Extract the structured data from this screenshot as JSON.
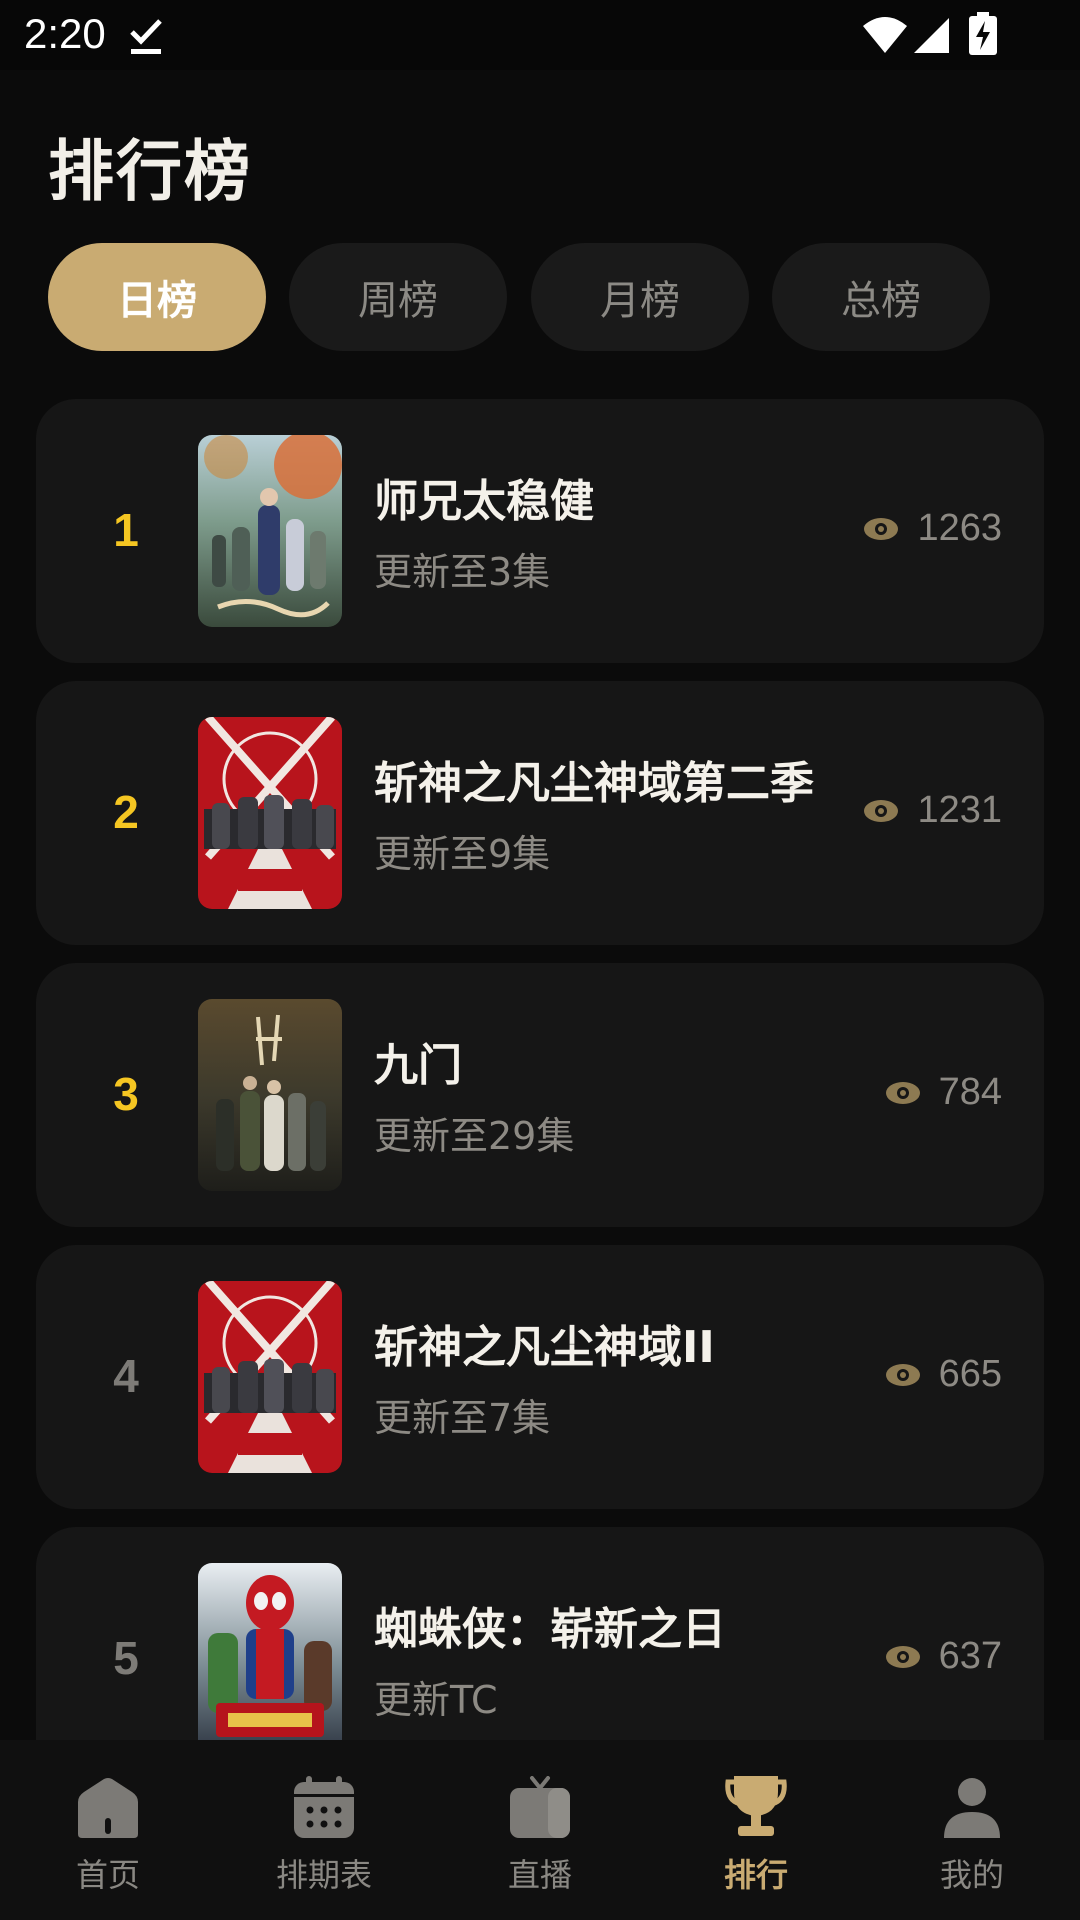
{
  "status_bar": {
    "time": "2:20"
  },
  "header": {
    "title": "排行榜"
  },
  "tabs": [
    {
      "label": "日榜",
      "active": true
    },
    {
      "label": "周榜",
      "active": false
    },
    {
      "label": "月榜",
      "active": false
    },
    {
      "label": "总榜",
      "active": false
    }
  ],
  "rankings": [
    {
      "rank": "1",
      "title": "师兄太稳健",
      "subtitle": "更新至3集",
      "views": "1263"
    },
    {
      "rank": "2",
      "title": "斩神之凡尘神域第二季",
      "subtitle": "更新至9集",
      "views": "1231"
    },
    {
      "rank": "3",
      "title": "九门",
      "subtitle": "更新至29集",
      "views": "784"
    },
    {
      "rank": "4",
      "title": "斩神之凡尘神域II",
      "subtitle": "更新至7集",
      "views": "665"
    },
    {
      "rank": "5",
      "title": "蜘蛛侠：崭新之日",
      "subtitle": "更新TC",
      "views": "637"
    }
  ],
  "bottom_nav": [
    {
      "label": "首页",
      "icon": "home-icon"
    },
    {
      "label": "排期表",
      "icon": "calendar-icon"
    },
    {
      "label": "直播",
      "icon": "tv-icon"
    },
    {
      "label": "排行",
      "icon": "trophy-icon",
      "active": true
    },
    {
      "label": "我的",
      "icon": "profile-icon"
    }
  ],
  "colors": {
    "accent": "#c9ab72",
    "top_rank": "#f5c622",
    "background": "#0b0b0b",
    "card": "#161616"
  }
}
